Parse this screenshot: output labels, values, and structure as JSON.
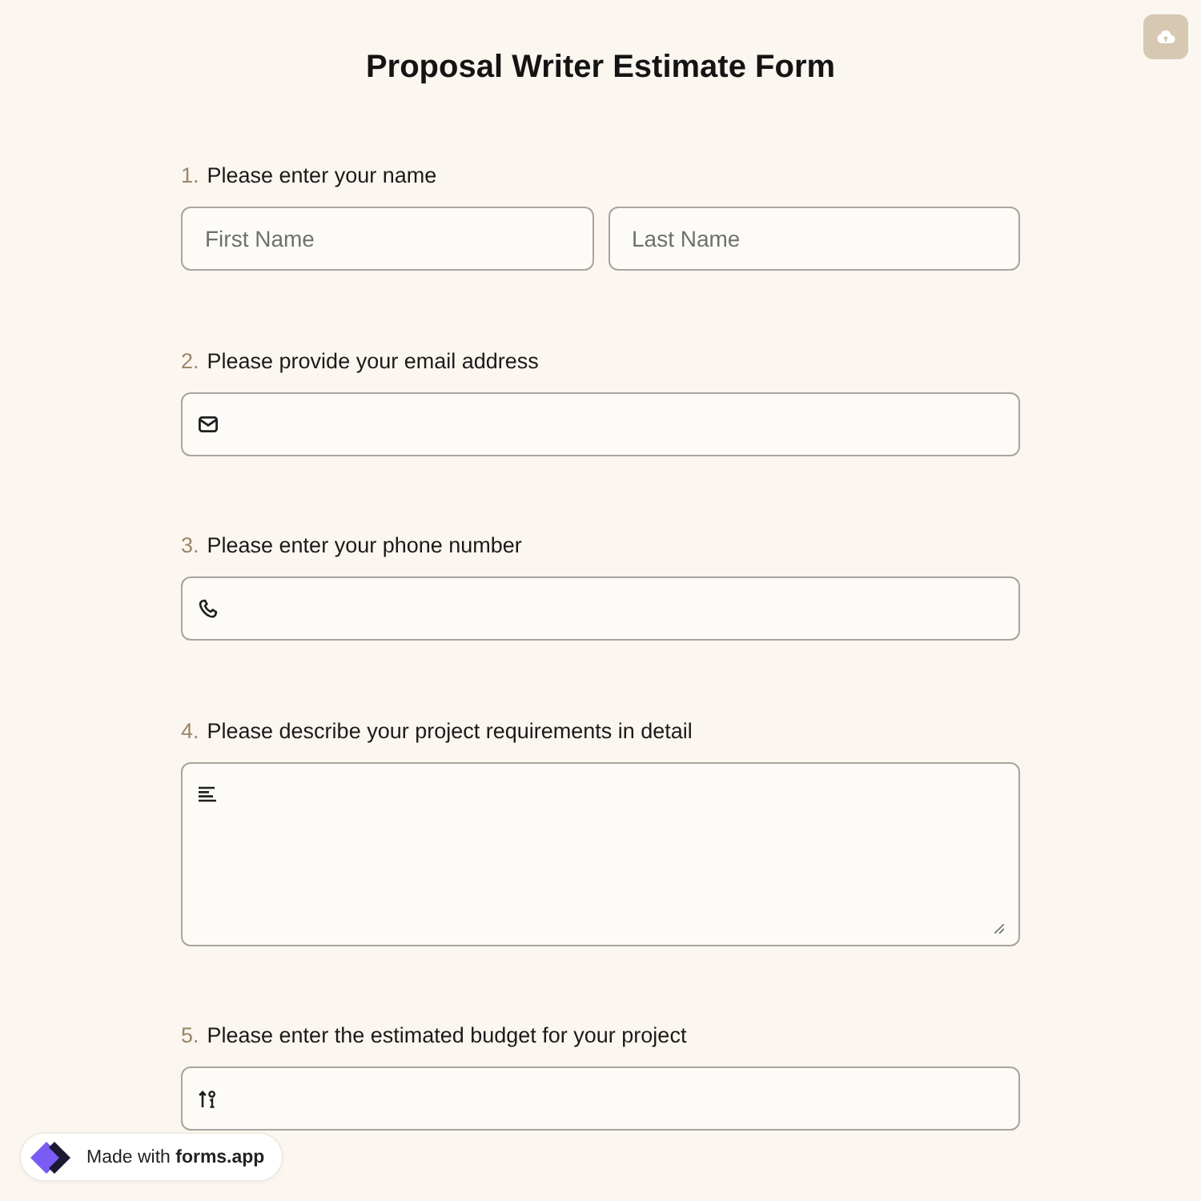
{
  "title": "Proposal Writer Estimate Form",
  "questions": [
    {
      "number": "1.",
      "label": "Please enter your name",
      "kind": "name",
      "fields": [
        {
          "placeholder": "First Name"
        },
        {
          "placeholder": "Last Name"
        }
      ]
    },
    {
      "number": "2.",
      "label": "Please provide your email address",
      "kind": "email"
    },
    {
      "number": "3.",
      "label": "Please enter your phone number",
      "kind": "phone"
    },
    {
      "number": "4.",
      "label": "Please describe your project requirements in detail",
      "kind": "textarea"
    },
    {
      "number": "5.",
      "label": "Please enter the estimated budget for your project",
      "kind": "number"
    }
  ],
  "badge": {
    "text": "Made with **forms.app**"
  }
}
